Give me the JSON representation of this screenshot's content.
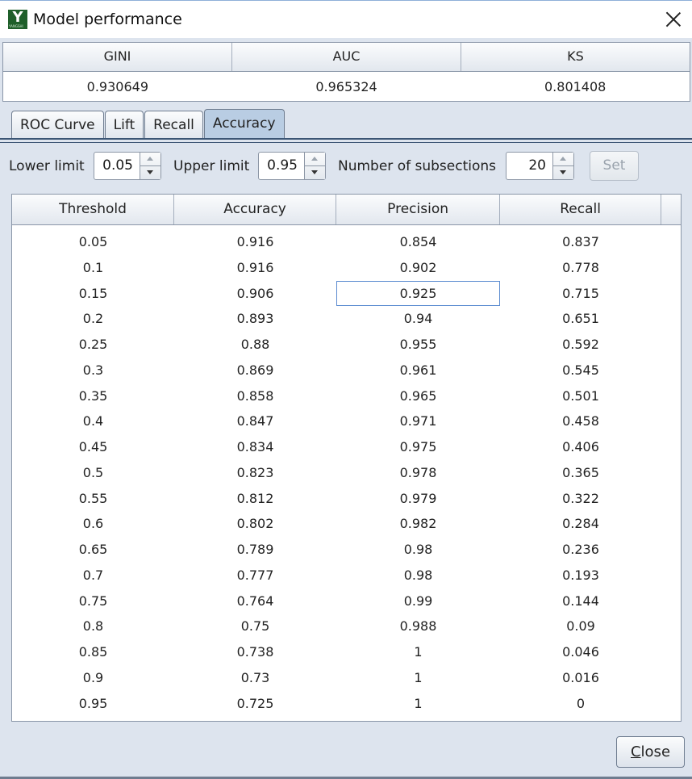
{
  "window": {
    "icon_letter": "Y",
    "icon_sub": "YANGSHI",
    "title": "Model performance"
  },
  "metrics": {
    "headers": [
      "GINI",
      "AUC",
      "KS"
    ],
    "values": [
      "0.930649",
      "0.965324",
      "0.801408"
    ]
  },
  "tabs": [
    "ROC Curve",
    "Lift",
    "Recall",
    "Accuracy"
  ],
  "active_tab": "Accuracy",
  "controls": {
    "lower_label": "Lower limit",
    "lower_value": "0.05",
    "upper_label": "Upper limit",
    "upper_value": "0.95",
    "subsections_label": "Number of subsections",
    "subsections_value": "20",
    "set_label": "Set"
  },
  "table": {
    "columns": [
      "Threshold",
      "Accuracy",
      "Precision",
      "Recall"
    ],
    "rows": [
      [
        "0.05",
        "0.916",
        "0.854",
        "0.837"
      ],
      [
        "0.1",
        "0.916",
        "0.902",
        "0.778"
      ],
      [
        "0.15",
        "0.906",
        "0.925",
        "0.715"
      ],
      [
        "0.2",
        "0.893",
        "0.94",
        "0.651"
      ],
      [
        "0.25",
        "0.88",
        "0.955",
        "0.592"
      ],
      [
        "0.3",
        "0.869",
        "0.961",
        "0.545"
      ],
      [
        "0.35",
        "0.858",
        "0.965",
        "0.501"
      ],
      [
        "0.4",
        "0.847",
        "0.971",
        "0.458"
      ],
      [
        "0.45",
        "0.834",
        "0.975",
        "0.406"
      ],
      [
        "0.5",
        "0.823",
        "0.978",
        "0.365"
      ],
      [
        "0.55",
        "0.812",
        "0.979",
        "0.322"
      ],
      [
        "0.6",
        "0.802",
        "0.982",
        "0.284"
      ],
      [
        "0.65",
        "0.789",
        "0.98",
        "0.236"
      ],
      [
        "0.7",
        "0.777",
        "0.98",
        "0.193"
      ],
      [
        "0.75",
        "0.764",
        "0.99",
        "0.144"
      ],
      [
        "0.8",
        "0.75",
        "0.988",
        "0.09"
      ],
      [
        "0.85",
        "0.738",
        "1",
        "0.046"
      ],
      [
        "0.9",
        "0.73",
        "1",
        "0.016"
      ],
      [
        "0.95",
        "0.725",
        "1",
        "0"
      ]
    ],
    "focused_row": 2,
    "focused_col": 2
  },
  "footer": {
    "close_mnemonic": "C",
    "close_rest": "lose"
  }
}
